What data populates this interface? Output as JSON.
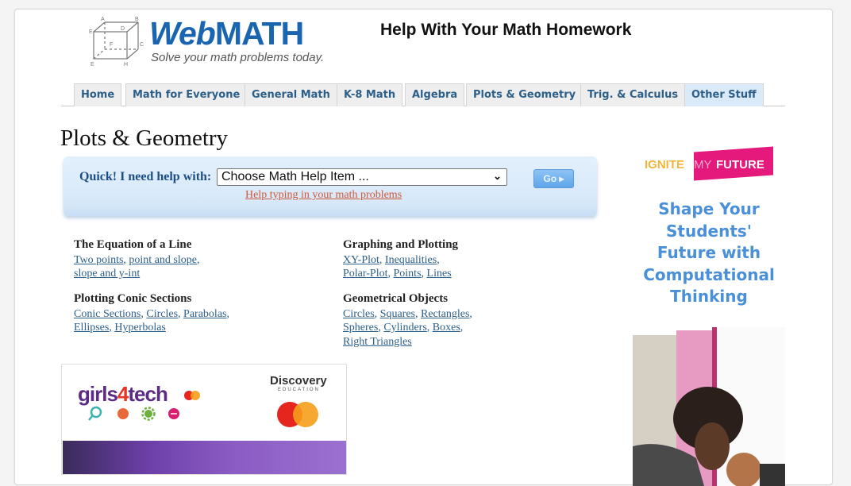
{
  "header": {
    "logo_word_web": "Web",
    "logo_word_math": "MATH",
    "logo_tagline": "Solve your math problems today.",
    "title": "Help With Your Math Homework"
  },
  "tabs": [
    {
      "label": "Home",
      "active": false
    },
    {
      "label": "Math for Everyone",
      "active": false
    },
    {
      "label": "General Math",
      "active": false
    },
    {
      "label": "K-8 Math",
      "active": false
    },
    {
      "label": "Algebra",
      "active": false
    },
    {
      "label": "Plots & Geometry",
      "active": false
    },
    {
      "label": "Trig. & Calculus",
      "active": false
    },
    {
      "label": "Other Stuff",
      "active": true
    }
  ],
  "page_title": "Plots & Geometry",
  "quick_help": {
    "label": "Quick! I need help with:",
    "select_value": "Choose Math Help Item ...",
    "go_label": "Go ▸",
    "help_link": "Help typing in your math problems"
  },
  "categories": [
    {
      "title": "The Equation of a Line",
      "links": [
        "Two points",
        "point and slope",
        "slope and y-int"
      ]
    },
    {
      "title": "Graphing and Plotting",
      "links": [
        "XY-Plot",
        "Inequalities",
        "Polar-Plot",
        "Points",
        "Lines"
      ]
    },
    {
      "title": "Plotting Conic Sections",
      "links": [
        "Conic Sections",
        "Circles",
        "Parabolas",
        "Ellipses",
        "Hyperbolas"
      ]
    },
    {
      "title": "Geometrical Objects",
      "links": [
        "Circles",
        "Squares",
        "Rectangles",
        "Spheres",
        "Cylinders",
        "Boxes",
        "Right Triangles"
      ]
    }
  ],
  "ads": {
    "left": {
      "brand_a": "girls",
      "brand_b": "4",
      "brand_c": "tech",
      "partner": "Discovery",
      "partner_sub": "EDUCATION"
    },
    "right": {
      "brand_ignite": "IGNITE",
      "brand_my": "MY",
      "brand_future": "FUTURE",
      "headline": [
        "Shape Your",
        "Students'",
        "Future with",
        "Computational",
        "Thinking"
      ]
    }
  },
  "colors": {
    "brand_blue": "#1a65b0",
    "tab_text": "#2c5f8a",
    "link": "#2c5f8a",
    "help_link": "#d0583a",
    "ad_pink": "#e5197c"
  }
}
